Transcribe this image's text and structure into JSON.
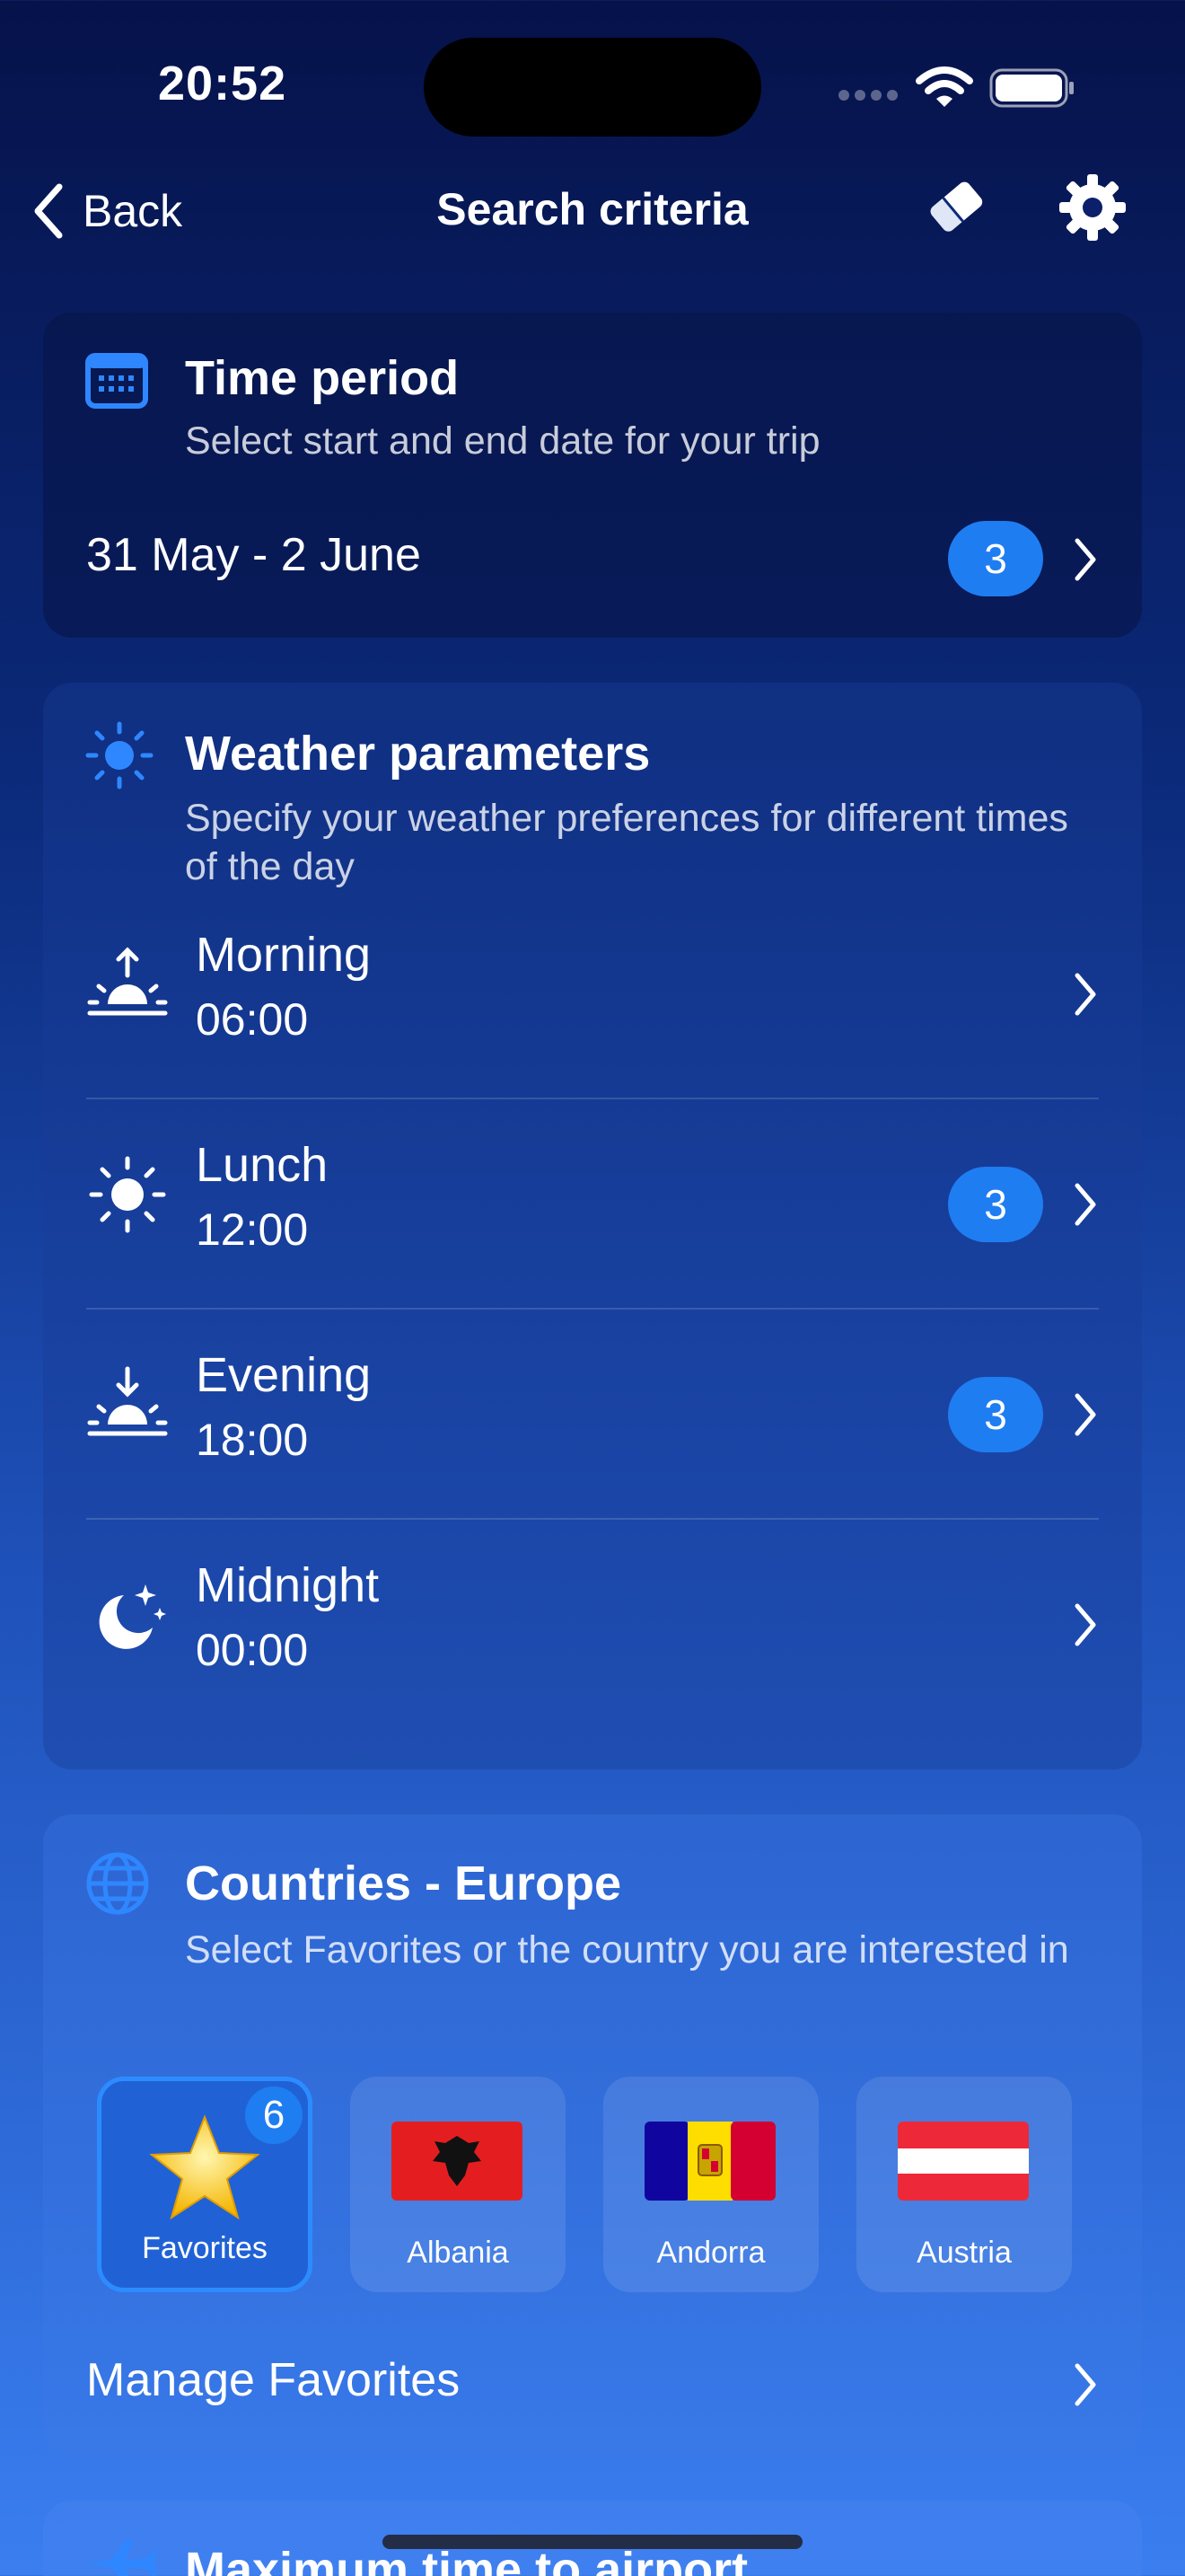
{
  "status_bar": {
    "time": "20:52"
  },
  "nav": {
    "back_label": "Back",
    "title": "Search criteria"
  },
  "time_period": {
    "title": "Time period",
    "subtitle": "Select start and end date for your trip",
    "value": "31 May - 2 June",
    "badge": "3"
  },
  "weather": {
    "title": "Weather parameters",
    "subtitle": "Specify your weather preferences for different times of the day",
    "rows": [
      {
        "label": "Morning",
        "time": "06:00",
        "badge": "",
        "icon": "sunrise-icon"
      },
      {
        "label": "Lunch",
        "time": "12:00",
        "badge": "3",
        "icon": "sun-icon"
      },
      {
        "label": "Evening",
        "time": "18:00",
        "badge": "3",
        "icon": "sunset-icon"
      },
      {
        "label": "Midnight",
        "time": "00:00",
        "badge": "",
        "icon": "moon-stars-icon"
      }
    ]
  },
  "countries": {
    "title": "Countries - Europe",
    "subtitle": "Select Favorites or the country you are interested in",
    "tiles": [
      {
        "name": "Favorites",
        "badge": "6",
        "selected": true,
        "icon": "star-icon"
      },
      {
        "name": "Albania",
        "selected": false,
        "icon": "albania-flag-icon"
      },
      {
        "name": "Andorra",
        "selected": false,
        "icon": "andorra-flag-icon"
      },
      {
        "name": "Austria",
        "selected": false,
        "icon": "austria-flag-icon"
      }
    ],
    "manage_label": "Manage Favorites"
  },
  "airport": {
    "title": "Maximum time to airport"
  },
  "colors": {
    "accent": "#1f7df2",
    "background_top": "#06124a",
    "background_bottom": "#3a7ef0"
  }
}
